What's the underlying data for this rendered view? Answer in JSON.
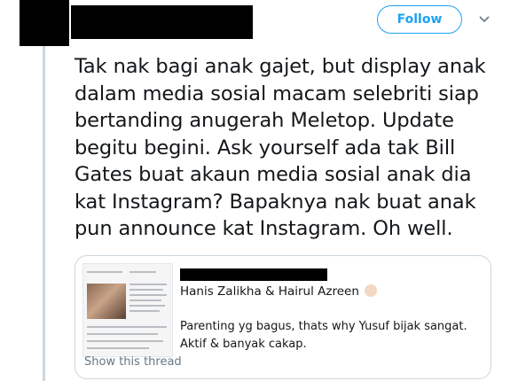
{
  "header": {
    "follow_label": "Follow",
    "caret_icon": "chevron-down-icon"
  },
  "tweet": {
    "lines": [
      "Tak nak bagi anak gajet, but display anak",
      "dalam media sosial macam selebriti siap",
      "bertanding anugerah Meletop.  Update",
      "begitu begini. Ask yourself ada tak Bill",
      "Gates buat akaun media sosial anak dia",
      "kat Instagram? Bapaknya nak buat anak",
      "pun announce kat Instagram. Oh well."
    ]
  },
  "quote": {
    "author": "Hanis Zalikha & Hairul Azreen",
    "body": "Parenting yg bagus, thats why Yusuf bijak sangat. Aktif & banyak cakap.",
    "show_thread": "Show this thread"
  },
  "colors": {
    "accent": "#1da1f2",
    "thread_line": "#ccd6dd",
    "muted_text": "#657786"
  }
}
